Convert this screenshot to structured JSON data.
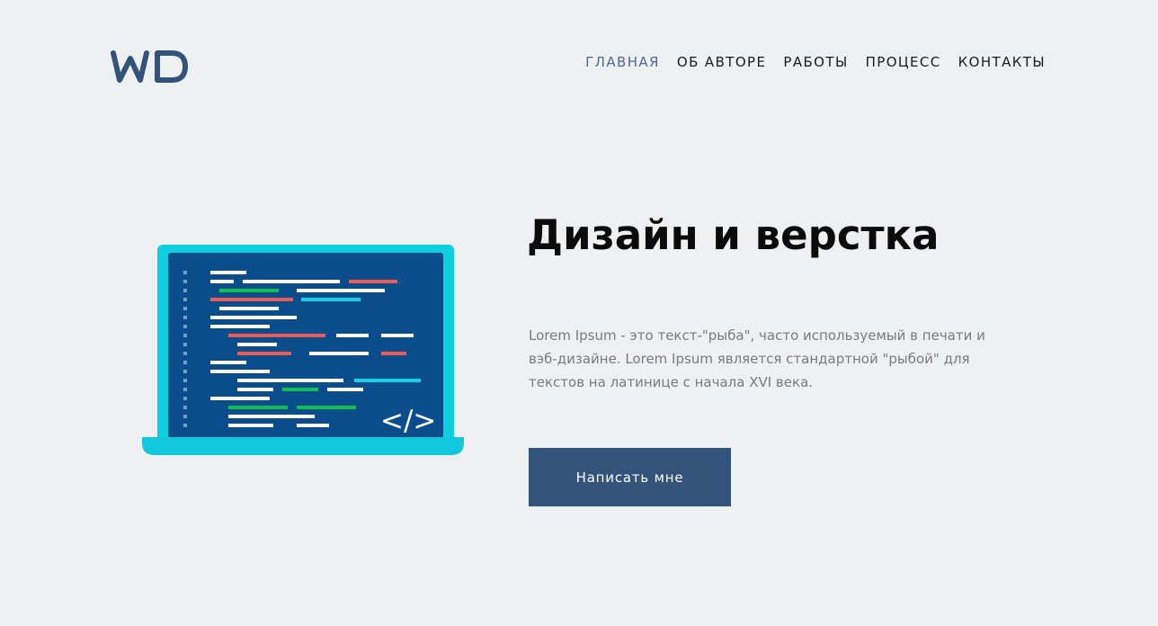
{
  "header": {
    "logo_text": "WD",
    "nav": [
      {
        "label": "ГЛАВНАЯ",
        "active": true
      },
      {
        "label": "ОБ АВТОРЕ",
        "active": false
      },
      {
        "label": "РАБОТЫ",
        "active": false
      },
      {
        "label": "ПРОЦЕСС",
        "active": false
      },
      {
        "label": "КОНТАКТЫ",
        "active": false
      }
    ]
  },
  "hero": {
    "title": "Дизайн и верстка",
    "text": "Lorem Ipsum - это текст-\"рыба\", часто используемый в печати и вэб-дизайне. Lorem Ipsum является стандартной \"рыбой\" для текстов на латинице с начала XVI века.",
    "button_label": "Написать мне",
    "illustration": {
      "code_symbol": "</>"
    }
  },
  "colors": {
    "background": "#eff0f2",
    "brand": "#33547a",
    "nav_active": "#4f6a8e",
    "laptop_frame": "#0ccfdf",
    "screen": "#0a4d8c",
    "code_red": "#f05a55",
    "code_green": "#11c04f",
    "code_cyan": "#18d1e6"
  }
}
